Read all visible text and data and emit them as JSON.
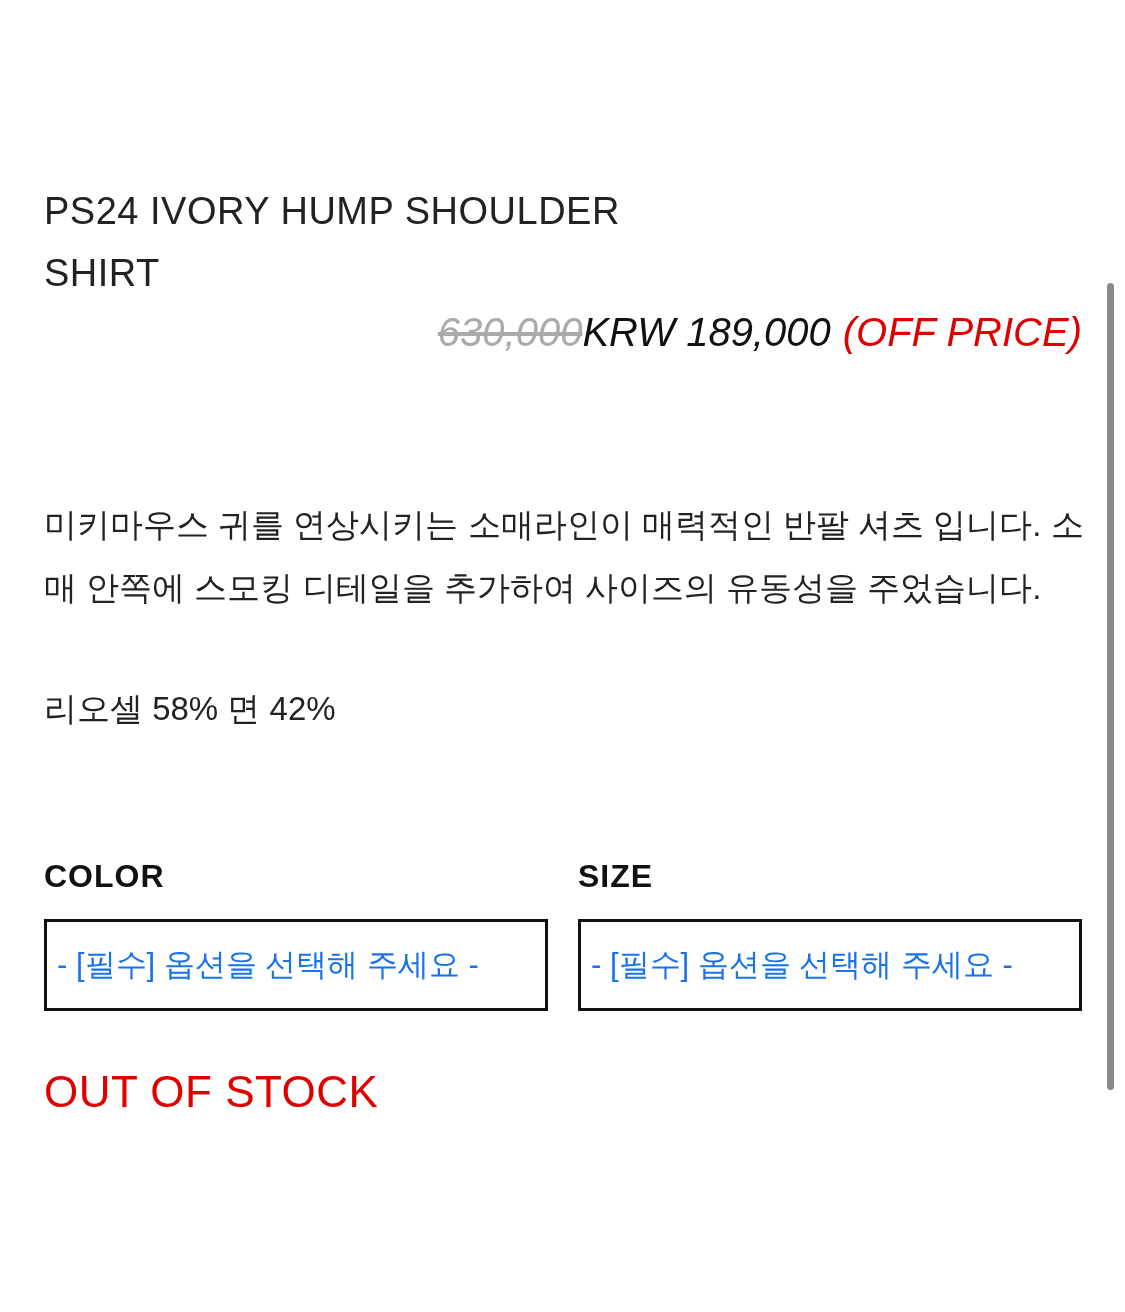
{
  "product": {
    "title": "PS24 IVORY HUMP SHOULDER SHIRT",
    "price": {
      "original": "630,000",
      "current": "KRW 189,000",
      "note": "(OFF PRICE)"
    },
    "description": "미키마우스 귀를 연상시키는 소매라인이 매력적인 반팔 셔츠 입니다. 소매 안쪽에 스모킹 디테일을 추가하여 사이즈의 유동성을 주었습니다.",
    "material": "리오셀 58% 면 42%"
  },
  "options": [
    {
      "label": "COLOR",
      "placeholder": "- [필수] 옵션을 선택해 주세요 -"
    },
    {
      "label": "SIZE",
      "placeholder": "- [필수] 옵션을 선택해 주세요 -"
    }
  ],
  "stock_status": "OUT OF STOCK"
}
